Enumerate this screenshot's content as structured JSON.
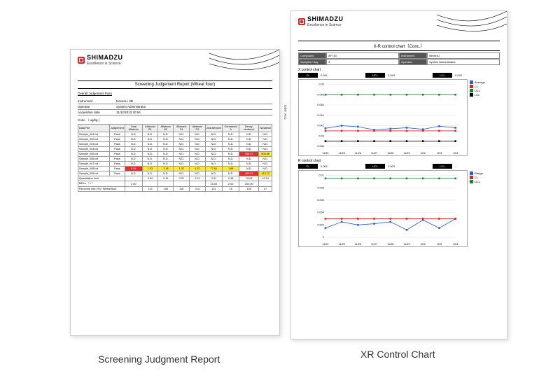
{
  "brand": {
    "name": "SHIMADZU",
    "tagline": "Excellence in Science"
  },
  "left": {
    "title": "Screening Judgement Report (Wheat flour)",
    "overall_k": "Overall Judgement",
    "overall_v": "Pass",
    "instrument_k": "Instrument",
    "instrument_v": "Nexera-i 3D",
    "operator_k": "Operator",
    "operator_v": "System Administrator",
    "acq_k": "Acquisition date",
    "acq_v": "11/12/2013 30:54",
    "unit": "Conc.（ ug/kg ）",
    "headers": [
      "Data File",
      "Judgement",
      "Total Aflatoxin",
      "Aflatoxin B1",
      "Aflatoxin B2",
      "Aflatoxin G1",
      "Aflatoxin G2",
      "Zearalenone",
      "Ochratoxin A",
      "Deoxy-nivalenol",
      "Nivalenol"
    ],
    "rows": [
      {
        "name": "Sample_001.lcd",
        "j": "Pass",
        "cells": [
          [
            "",
            "N.D."
          ],
          [
            "",
            "N.D."
          ],
          [
            "",
            "N.D."
          ],
          [
            "",
            "N.D."
          ],
          [
            "",
            "N.D."
          ],
          [
            "",
            "N.D."
          ],
          [
            "",
            "N.D."
          ],
          [
            "",
            "N.D."
          ],
          [
            "",
            "N.D."
          ]
        ]
      },
      {
        "name": "Sample_002.lcd",
        "j": "Pass",
        "cells": [
          [
            "",
            "N.D."
          ],
          [
            "",
            "N.D."
          ],
          [
            "",
            "N.D."
          ],
          [
            "",
            "N.D."
          ],
          [
            "",
            "N.D."
          ],
          [
            "",
            "N.D."
          ],
          [
            "",
            "N.D."
          ],
          [
            "",
            "N.D."
          ],
          [
            "",
            "N.D."
          ]
        ]
      },
      {
        "name": "Sample_003.lcd",
        "j": "Pass",
        "cells": [
          [
            "",
            "N.D."
          ],
          [
            "",
            "N.D."
          ],
          [
            "",
            "N.D."
          ],
          [
            "",
            "N.D."
          ],
          [
            "",
            "N.D."
          ],
          [
            "",
            "N.D."
          ],
          [
            "",
            "N.D."
          ],
          [
            "",
            "N.D."
          ],
          [
            "",
            "N.D."
          ]
        ]
      },
      {
        "name": "Sample_004.lcd",
        "j": "Pass",
        "cells": [
          [
            "",
            "N.D."
          ],
          [
            "",
            "N.D."
          ],
          [
            "",
            "N.D."
          ],
          [
            "",
            "N.D."
          ],
          [
            "",
            "N.D."
          ],
          [
            "",
            "N.D."
          ],
          [
            "",
            "N.D."
          ],
          [
            "",
            "N.D."
          ],
          [
            "",
            "N.D."
          ]
        ]
      },
      {
        "name": "Sample_005.lcd",
        "j": "Pass",
        "cells": [
          [
            "",
            "N.D."
          ],
          [
            "",
            "N.D."
          ],
          [
            "",
            "N.D."
          ],
          [
            "",
            "N.D."
          ],
          [
            "",
            "N.D."
          ],
          [
            "",
            "N.D."
          ],
          [
            "",
            "N.D."
          ],
          [
            "r",
            "306.27"
          ],
          [
            "y",
            "803.66"
          ]
        ]
      },
      {
        "name": "Sample_006.lcd",
        "j": "Pass",
        "cells": [
          [
            "",
            "N.D."
          ],
          [
            "",
            "N.D."
          ],
          [
            "",
            "N.D."
          ],
          [
            "",
            "N.D."
          ],
          [
            "",
            "N.D."
          ],
          [
            "",
            "N.D."
          ],
          [
            "",
            "N.D."
          ],
          [
            "",
            "N.D."
          ],
          [
            "",
            "N.D."
          ]
        ]
      },
      {
        "name": "Sample_007.lcd",
        "j": "Pass",
        "cells": [
          [
            "",
            "N.D."
          ],
          [
            "",
            "N.D."
          ],
          [
            "",
            "N.D."
          ],
          [
            "",
            "N.D."
          ],
          [
            "",
            "N.D."
          ],
          [
            "",
            "N.D."
          ],
          [
            "",
            "N.D."
          ],
          [
            "",
            "N.D."
          ],
          [
            "",
            "N.D."
          ]
        ]
      },
      {
        "name": "Sample_008.lcd",
        "j": "Pass",
        "cells": [
          [
            "r",
            "5.51"
          ],
          [
            "y",
            "1.53"
          ],
          [
            "y",
            "1.18"
          ],
          [
            "y",
            "1.37"
          ],
          [
            "y",
            "1.37"
          ],
          [
            "y",
            "77.61"
          ],
          [
            "y",
            "1.88"
          ],
          [
            "",
            "N.D."
          ],
          [
            "",
            "N.D."
          ]
        ]
      },
      {
        "name": "Sample_009.lcd",
        "j": "Pass",
        "cells": [
          [
            "",
            "N.D."
          ],
          [
            "",
            "N.D."
          ],
          [
            "",
            "N.D."
          ],
          [
            "",
            "N.D."
          ],
          [
            "",
            "N.D."
          ],
          [
            "",
            "N.D."
          ],
          [
            "",
            "N.D."
          ],
          [
            "r",
            "408.31"
          ],
          [
            "y",
            "410.72"
          ]
        ]
      }
    ],
    "footer": [
      {
        "name": "Quantitative limit",
        "cells": [
          "",
          "0.34",
          "0.31",
          "0.31",
          "0.31",
          "0.31",
          "0.38",
          "78.08",
          "16.34"
        ]
      },
      {
        "name": "MRLs （ / ）",
        "cells": [
          "2.00",
          "",
          "",
          "",
          "",
          "20.00",
          "2.00",
          "200.00",
          ""
        ]
      },
      {
        "name": "Recovery rate (%) / Wheat flour",
        "cells": [
          "",
          "113",
          "106",
          "118",
          "114",
          "114",
          "16",
          "100",
          "47"
        ]
      }
    ]
  },
  "right": {
    "title": "X-R control chart（Conc.）",
    "info": {
      "compound_k": "Compound",
      "compound_v": "AF743",
      "instrument_k": "Instrument",
      "instrument_v": "Nexera-i",
      "samples_k": "Samples / day",
      "samples_v": "3",
      "operator_k": "Operator",
      "operator_v": "System Administrator"
    },
    "x_section": "X control chart",
    "x_stats": {
      "cl_k": "CL",
      "cl_v": "0.041",
      "ucl_k": "UCL",
      "ucl_v": "0.043",
      "lcl_k": "LCL",
      "lcl_v": "0.040"
    },
    "r_section": "R control chart",
    "r_stats": {
      "cl_k": "CL",
      "cl_v": "0.001",
      "ucl_k": "UCL",
      "ucl_v": "0.003",
      "lcl_k": "LCL",
      "lcl_v": "-"
    },
    "x_legend": [
      "Average",
      "CL",
      "UCL",
      "LCL"
    ],
    "r_legend": [
      "Range",
      "CL",
      "UCL"
    ],
    "ylabel": "Conc. (ug/L)"
  },
  "chart_data": [
    {
      "type": "line",
      "title": "X control chart",
      "categories": [
        "11/24",
        "11/25",
        "11/26",
        "11/27",
        "11/28",
        "11/29",
        "12/2",
        "12/3",
        "12/4"
      ],
      "ylabel": "Conc. (ug/L)",
      "ylim": [
        0.038,
        0.05
      ],
      "yticks": [
        0.038,
        0.04,
        0.042,
        0.044,
        0.046,
        0.048,
        0.05
      ],
      "series": [
        {
          "name": "Average",
          "color": "#2a5fd6",
          "values": [
            0.0415,
            0.042,
            0.0418,
            0.0412,
            0.0414,
            0.0416,
            0.0413,
            0.0419,
            0.0416
          ]
        },
        {
          "name": "CL",
          "color": "#d22",
          "values": [
            0.041,
            0.041,
            0.041,
            0.041,
            0.041,
            0.041,
            0.041,
            0.041,
            0.041
          ]
        },
        {
          "name": "UCL",
          "color": "#0a8a2a",
          "values": [
            0.048,
            0.048,
            0.048,
            0.048,
            0.048,
            0.048,
            0.048,
            0.048,
            0.048
          ]
        },
        {
          "name": "LCL",
          "color": "#000",
          "values": [
            0.039,
            0.039,
            0.039,
            0.039,
            0.039,
            0.039,
            0.039,
            0.039,
            0.039
          ]
        }
      ]
    },
    {
      "type": "line",
      "title": "R control chart",
      "categories": [
        "11/24",
        "11/25",
        "11/26",
        "11/27",
        "11/28",
        "11/29",
        "12/2",
        "12/3",
        "12/4"
      ],
      "ylim": [
        0,
        0.01
      ],
      "yticks": [
        0,
        0.002,
        0.004,
        0.006,
        0.008,
        0.01
      ],
      "series": [
        {
          "name": "Range",
          "color": "#2a5fd6",
          "values": [
            0.0015,
            0.0025,
            0.002,
            0.0022,
            0.0025,
            0.0012,
            0.0028,
            0.0015,
            0.003
          ]
        },
        {
          "name": "CL",
          "color": "#d22",
          "values": [
            0.003,
            0.003,
            0.003,
            0.003,
            0.003,
            0.003,
            0.003,
            0.003,
            0.003
          ]
        },
        {
          "name": "UCL",
          "color": "#0a8a2a",
          "values": [
            0.0095,
            0.0095,
            0.0095,
            0.0095,
            0.0095,
            0.0095,
            0.0095,
            0.0095,
            0.0095
          ]
        }
      ]
    }
  ],
  "captions": {
    "left": "Screening Judgment Report",
    "right": "XR Control Chart"
  }
}
